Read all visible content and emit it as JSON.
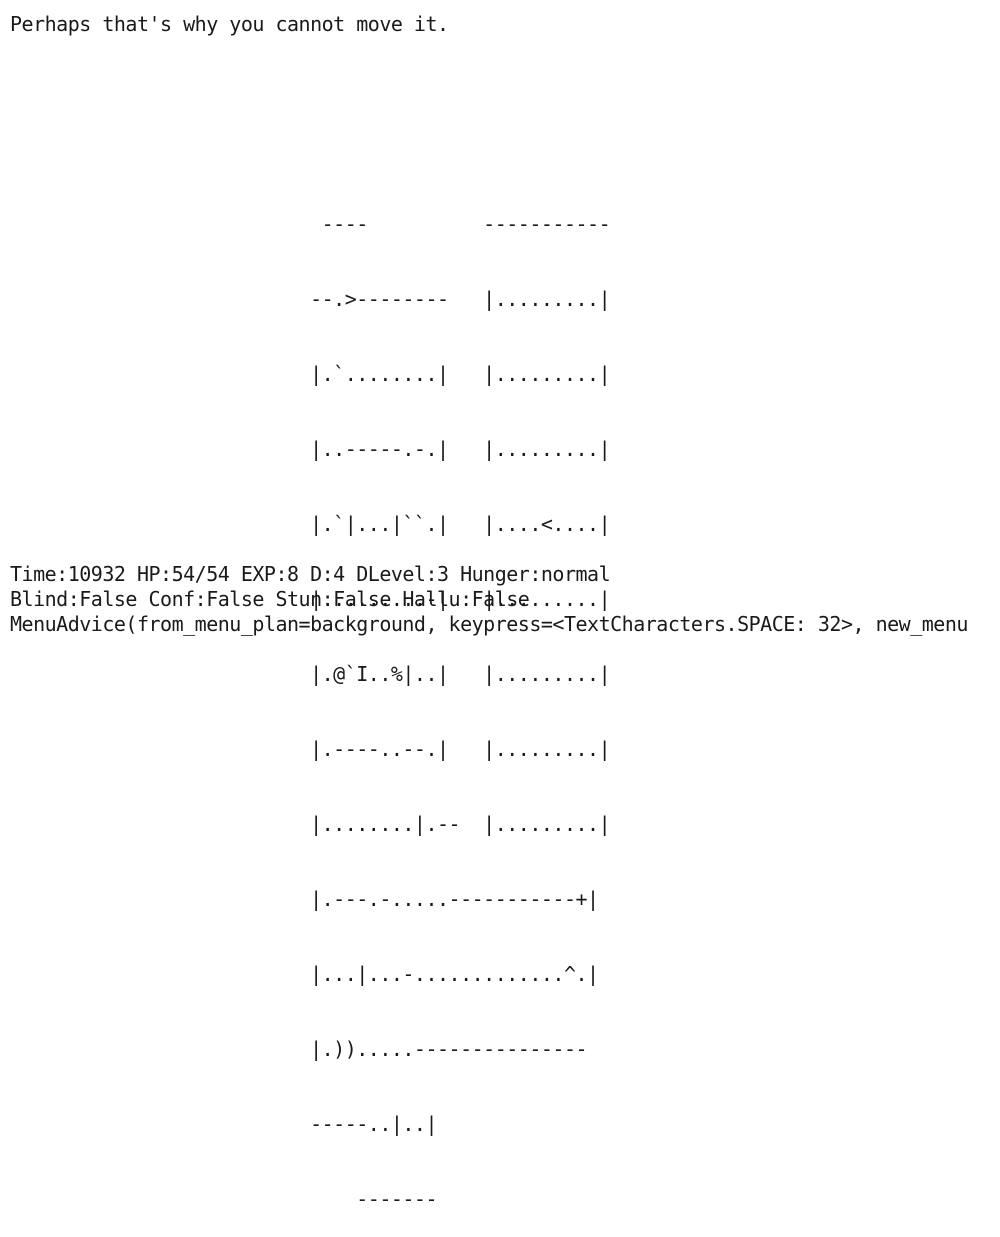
{
  "message": "Perhaps that's why you cannot move it.",
  "map_rows": [
    "                           ----          -----------",
    "                          --.>--------   |.........|",
    "                          |.`........|   |.........|",
    "                          |..-----.-.|   |.........|",
    "                          |.`|...|``.|   |....<....|",
    "                          |.........-|   |.........|",
    "                          |.@`I..%|..|   |.........|",
    "                          |.----..--.|   |.........|",
    "                          |........|.--  |.........|",
    "                          |.---.-.....-----------+|",
    "                          |...|...-.............^.|",
    "                          |.)).....---------------",
    "                          -----..|..|",
    "                              -------"
  ],
  "status": {
    "line1": "Time:10932 HP:54/54 EXP:8 D:4 DLevel:3 Hunger:normal",
    "line2": "Blind:False Conf:False Stun:False Hallu:False",
    "line3": "MenuAdvice(from_menu_plan=background, keypress=<TextCharacters.SPACE: 32>, new_menu"
  }
}
